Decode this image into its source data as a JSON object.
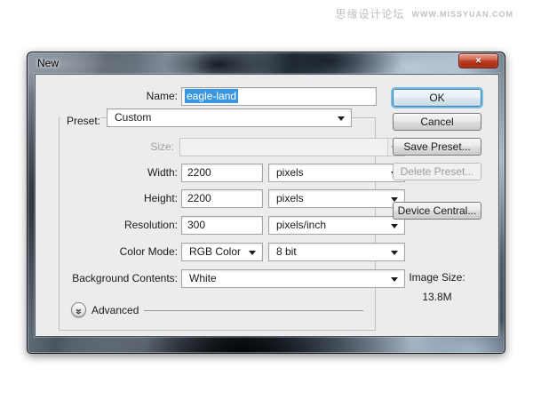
{
  "watermark": {
    "site_name": "思缘设计论坛",
    "site_url": "WWW.MISSYUAN.COM"
  },
  "icons": {
    "close_glyph": "✕",
    "advanced_chevron": "»"
  },
  "dialog": {
    "title": "New",
    "fields": {
      "name": {
        "label": "Name:",
        "value": "eagle-land"
      },
      "preset": {
        "label": "Preset:",
        "value": "Custom"
      },
      "size": {
        "label": "Size:",
        "value": ""
      },
      "width": {
        "label": "Width:",
        "value": "2200",
        "unit": "pixels"
      },
      "height": {
        "label": "Height:",
        "value": "2200",
        "unit": "pixels"
      },
      "resolution": {
        "label": "Resolution:",
        "value": "300",
        "unit": "pixels/inch"
      },
      "color_mode": {
        "label": "Color Mode:",
        "value": "RGB Color",
        "depth": "8 bit"
      },
      "background_contents": {
        "label": "Background Contents:",
        "value": "White"
      }
    },
    "advanced": {
      "label": "Advanced"
    },
    "buttons": {
      "ok": "OK",
      "cancel": "Cancel",
      "save_preset": "Save Preset...",
      "delete_preset": "Delete Preset...",
      "device_central": "Device Central..."
    },
    "image_size": {
      "label": "Image Size:",
      "value": "13.8M"
    }
  },
  "colors": {
    "selection_blue": "#3b96e0",
    "content_bg": "#ececec",
    "close_red": "#bd3a1f",
    "default_button_glow": "#6cb9e6",
    "watermark_gray": "#bdbdbd"
  }
}
